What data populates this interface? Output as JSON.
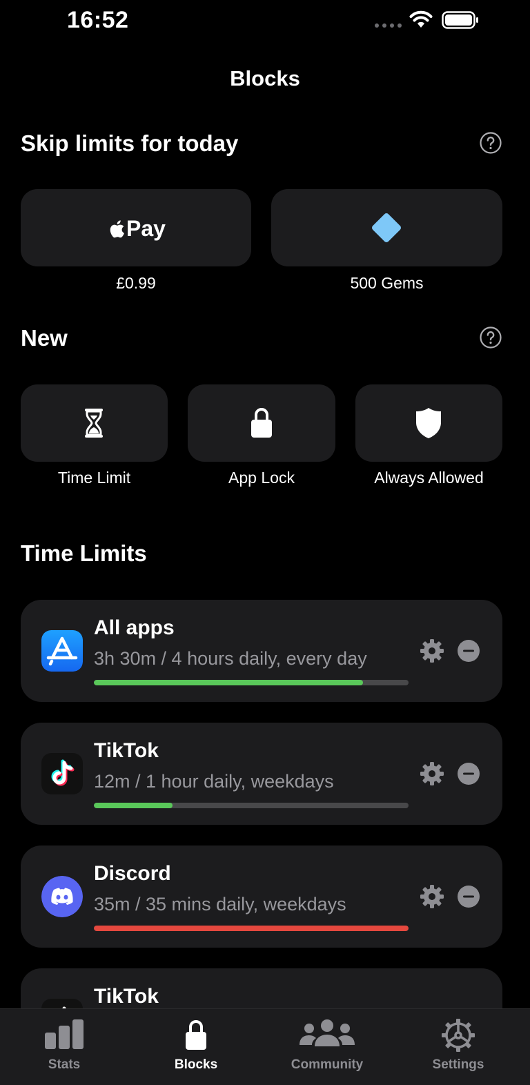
{
  "status_bar": {
    "time": "16:52"
  },
  "nav": {
    "title": "Blocks"
  },
  "skip": {
    "title": "Skip limits for today",
    "pay_button_text": "Pay",
    "pay_price": "£0.99",
    "gems_label": "500 Gems"
  },
  "new_section": {
    "title": "New",
    "items": [
      {
        "label": "Time Limit",
        "icon": "hourglass-icon"
      },
      {
        "label": "App Lock",
        "icon": "lock-icon"
      },
      {
        "label": "Always Allowed",
        "icon": "shield-icon"
      }
    ]
  },
  "time_limits": {
    "title": "Time Limits",
    "items": [
      {
        "name": "All apps",
        "detail": "3h 30m / 4 hours daily, every day",
        "progress": 0.855,
        "bar_color": "#5ac85a",
        "icon": "app-store-icon"
      },
      {
        "name": "TikTok",
        "detail": "12m / 1 hour daily, weekdays",
        "progress": 0.25,
        "bar_color": "#5ac85a",
        "icon": "tiktok-icon"
      },
      {
        "name": "Discord",
        "detail": "35m / 35 mins daily, weekdays",
        "progress": 1.0,
        "bar_color": "#e5483e",
        "icon": "discord-icon"
      },
      {
        "name": "TikTok",
        "detail": "",
        "progress": 0,
        "bar_color": "#5ac85a",
        "icon": "tiktok-icon"
      }
    ]
  },
  "tab_bar": {
    "tabs": [
      {
        "label": "Stats",
        "icon": "bar-chart-icon",
        "active": false
      },
      {
        "label": "Blocks",
        "icon": "lock-icon",
        "active": true
      },
      {
        "label": "Community",
        "icon": "people-icon",
        "active": false
      },
      {
        "label": "Settings",
        "icon": "gear-icon",
        "active": false
      }
    ]
  },
  "colors": {
    "background": "#000000",
    "card": "#1c1c1e",
    "gem": "#7ec8f8",
    "progress_ok": "#5ac85a",
    "progress_over": "#e5483e",
    "discord": "#5865f2",
    "app_store": "#1a8cff"
  }
}
